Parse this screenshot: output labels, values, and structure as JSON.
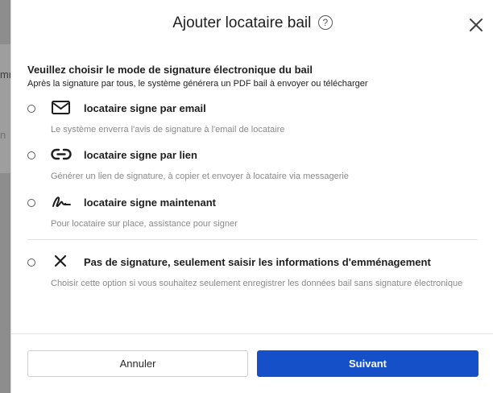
{
  "background": {
    "fragment_1": "mm",
    "fragment_2": "n"
  },
  "modal": {
    "title": "Ajouter locataire bail",
    "help_icon": "question-circle-icon",
    "close_icon": "close-icon",
    "intro_title": "Veuillez choisir le mode de signature électronique du bail",
    "intro_subtitle": "Après la signature par tous, le système générera un PDF bail à envoyer ou télécharger",
    "options": [
      {
        "icon": "envelope-icon",
        "label": "locataire signe par email",
        "description": "Le système enverra l'avis de signature à l'email de locataire"
      },
      {
        "icon": "link-icon",
        "label": "locataire signe par lien",
        "description": "Générer un lien de signature, à copier et envoyer à locataire via messagerie"
      },
      {
        "icon": "signature-icon",
        "label": "locataire signe maintenant",
        "description": "Pour locataire sur place, assistance pour signer"
      },
      {
        "icon": "x-icon",
        "label": "Pas de signature, seulement saisir les informations d'emménagement",
        "description": "Choisir cette option si vous souhaitez seulement enregistrer les données bail sans signature électronique"
      }
    ],
    "buttons": {
      "cancel": "Annuler",
      "next": "Suivant"
    },
    "colors": {
      "primary": "#1650c9",
      "muted_text": "#8a8a8a"
    }
  }
}
